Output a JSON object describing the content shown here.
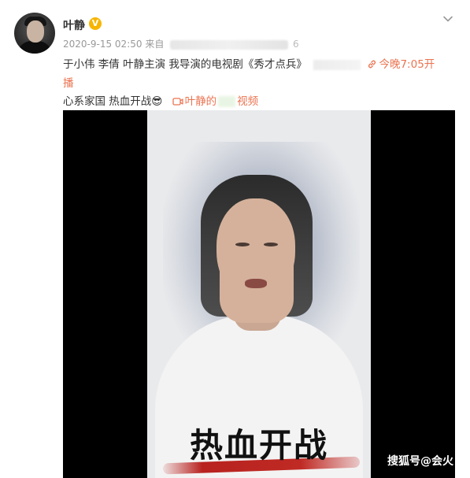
{
  "post": {
    "username": "叶静",
    "verified_badge": "V",
    "timestamp": "2020-9-15 02:50",
    "source_prefix": "来自",
    "source_tail": "6",
    "text_line1_a": "于小伟 李倩 叶静主演 我导演的电视剧《秀才点兵》",
    "text_line1_link": "今晚7:05开",
    "text_line2": "播",
    "text_line3_a": "心系家国 热血开战",
    "text_line3_emoji": "😎",
    "video_link_label": "叶静的",
    "video_link_suffix": "视频"
  },
  "video": {
    "overlay_title": "热血开战",
    "watermark": "搜狐号@会火"
  },
  "icons": {
    "chevron": "chevron-down-icon",
    "link": "link-icon",
    "video": "video-icon"
  },
  "colors": {
    "accent": "#eb7350",
    "badge": "#f7b500",
    "text": "#333333",
    "meta": "#999999"
  }
}
